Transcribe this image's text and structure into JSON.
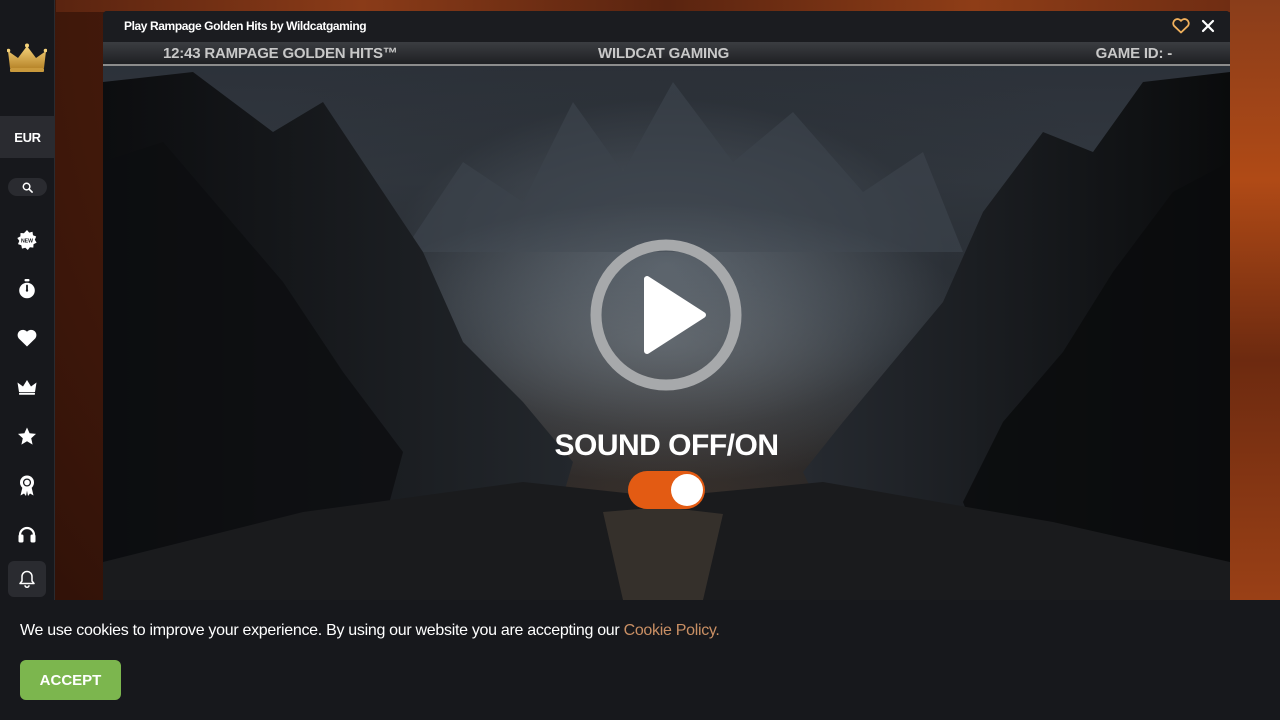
{
  "window": {
    "title": "Play Rampage Golden Hits by Wildcatgaming"
  },
  "sidebar": {
    "currency": "EUR",
    "items": [
      {
        "icon": "new-badge-icon"
      },
      {
        "icon": "stopwatch-icon"
      },
      {
        "icon": "heart-icon"
      },
      {
        "icon": "crown-icon"
      },
      {
        "icon": "star-icon"
      },
      {
        "icon": "award-ribbon-icon"
      },
      {
        "icon": "headset-icon"
      },
      {
        "icon": "bell-icon"
      }
    ]
  },
  "game": {
    "info_left": "12:43 RAMPAGE GOLDEN HITS™",
    "info_center": "WILDCAT GAMING",
    "info_right": "GAME ID: -",
    "sound_label": "SOUND OFF/ON",
    "sound_on": true
  },
  "cookie": {
    "text": "We use cookies to improve your experience. By using our website you are accepting our ",
    "link": "Cookie Policy.",
    "accept": "ACCEPT"
  },
  "colors": {
    "accent": "#e35b13",
    "accept": "#7cb64e",
    "link": "#c98f64",
    "sidebar_bg": "#17181c"
  }
}
